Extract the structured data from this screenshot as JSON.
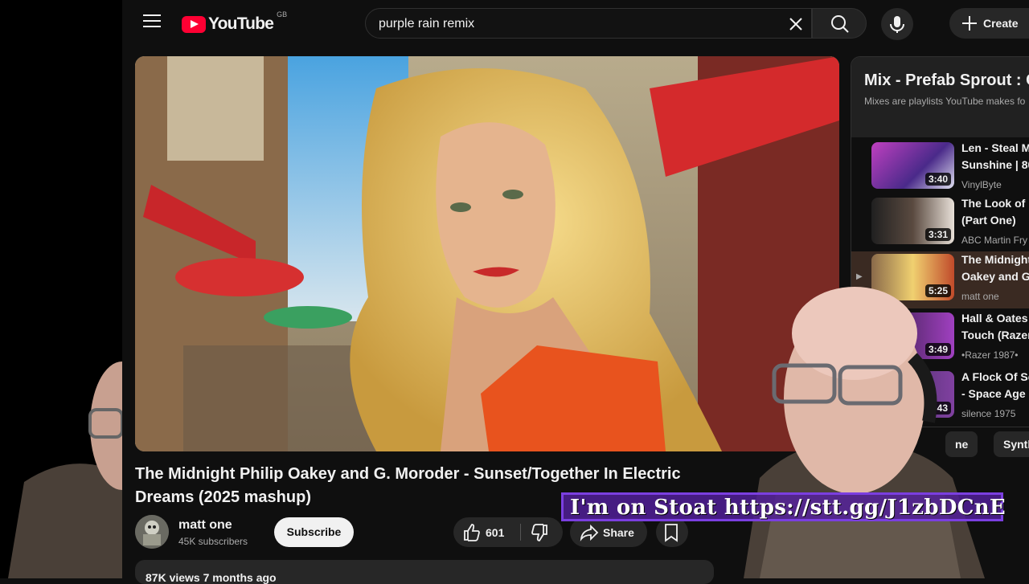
{
  "header": {
    "logo_text": "YouTube",
    "region": "GB",
    "search_value": "purple rain remix",
    "create_label": "Create"
  },
  "video": {
    "title": "The Midnight Philip Oakey and G. Moroder - Sunset/Together In Electric Dreams (2025 mashup)",
    "channel": "matt one",
    "subscribers": "45K subscribers",
    "subscribe_label": "Subscribe",
    "likes": "601",
    "share_label": "Share",
    "views_date": "87K views  7 months ago"
  },
  "playlist": {
    "title": "Mix - Prefab Sprout : C",
    "subtitle": "Mixes are playlists YouTube makes fo",
    "items": [
      {
        "title_line1": "Len - Steal M",
        "title_line2": "Sunshine | 80",
        "channel": "VinylByte",
        "duration": "3:40",
        "active": false
      },
      {
        "title_line1": "The Look of L",
        "title_line2": "(Part One)",
        "channel": "ABC Martin Fry",
        "duration": "3:31",
        "active": false
      },
      {
        "title_line1": "The Midnight",
        "title_line2": "Oakey and G.",
        "channel": "matt one",
        "duration": "5:25",
        "active": true
      },
      {
        "title_line1": "Hall & Oates -",
        "title_line2": "Touch (Razer",
        "channel": "•Razer 1987•",
        "duration": "3:49",
        "active": false
      },
      {
        "title_line1": "A Flock Of Se",
        "title_line2": "- Space Age L",
        "channel": "silence 1975",
        "duration": "4:43",
        "active": false
      }
    ]
  },
  "chips": [
    "ne",
    "Synth"
  ],
  "overlay": {
    "stoat_text": "I'm on Stoat  https://stt.gg/J1zbDCnE"
  },
  "colors": {
    "brand_red": "#ff0033",
    "background": "#0f0f0f",
    "overlay_purple": "#7b3fe0"
  }
}
